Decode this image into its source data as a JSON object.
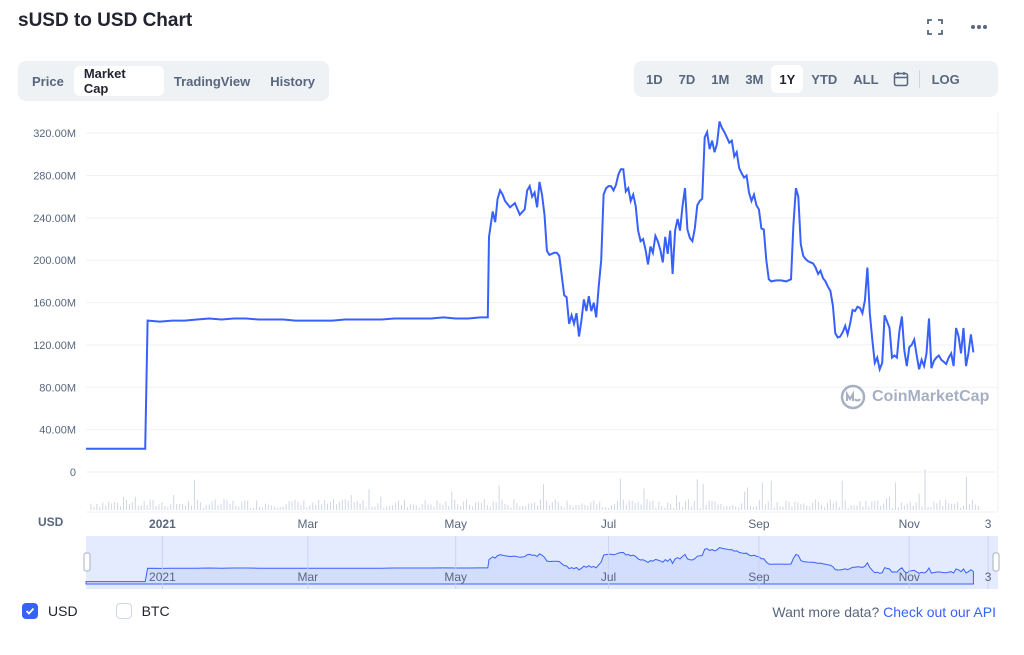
{
  "header": {
    "title": "sUSD to USD Chart"
  },
  "icons": {
    "fullscreen": "fullscreen-icon",
    "more": "more-icon",
    "calendar": "calendar-icon",
    "logo": "coinmarketcap-logo-icon"
  },
  "tabs": [
    {
      "label": "Price",
      "active": false
    },
    {
      "label": "Market Cap",
      "active": true
    },
    {
      "label": "TradingView",
      "active": false
    },
    {
      "label": "History",
      "active": false
    }
  ],
  "ranges": [
    {
      "label": "1D",
      "active": false
    },
    {
      "label": "7D",
      "active": false
    },
    {
      "label": "1M",
      "active": false
    },
    {
      "label": "3M",
      "active": false
    },
    {
      "label": "1Y",
      "active": true
    },
    {
      "label": "YTD",
      "active": false
    },
    {
      "label": "ALL",
      "active": false
    }
  ],
  "log_label": "LOG",
  "watermark": "CoinMarketCap",
  "currency_label": "USD",
  "legend": [
    {
      "label": "USD",
      "checked": true
    },
    {
      "label": "BTC",
      "checked": false
    }
  ],
  "footer": {
    "prefix": "Want more data?",
    "link": "Check out our API"
  },
  "colors": {
    "line": "#3861fb",
    "grid": "#eff2f5",
    "text": "#58667e",
    "volume": "#cfd6e4",
    "navigator": "#e5ebff"
  },
  "chart_data": {
    "type": "line",
    "series": [
      {
        "name": "USD",
        "values_in_millions": true
      }
    ],
    "ylabel": "",
    "ylim": [
      0,
      340
    ],
    "yticks": [
      "0",
      "40.00M",
      "80.00M",
      "120.00M",
      "160.00M",
      "200.00M",
      "240.00M",
      "280.00M",
      "320.00M"
    ],
    "ytick_values": [
      0,
      40,
      80,
      120,
      160,
      200,
      240,
      280,
      320
    ],
    "xticks": [
      "2021",
      "Mar",
      "May",
      "Jul",
      "Sep",
      "Nov",
      "3"
    ],
    "xtick_positions_days": [
      31,
      90,
      150,
      212,
      273,
      334,
      366
    ],
    "xlim_days": [
      0,
      370
    ],
    "points": [
      [
        0,
        22
      ],
      [
        24,
        22
      ],
      [
        25,
        143
      ],
      [
        30,
        142
      ],
      [
        35,
        143
      ],
      [
        40,
        143
      ],
      [
        45,
        144
      ],
      [
        50,
        145
      ],
      [
        55,
        144
      ],
      [
        60,
        145
      ],
      [
        65,
        145
      ],
      [
        70,
        144
      ],
      [
        75,
        144
      ],
      [
        80,
        144
      ],
      [
        85,
        143
      ],
      [
        90,
        143
      ],
      [
        95,
        143
      ],
      [
        100,
        143
      ],
      [
        105,
        144
      ],
      [
        110,
        144
      ],
      [
        115,
        144
      ],
      [
        120,
        144
      ],
      [
        125,
        145
      ],
      [
        130,
        145
      ],
      [
        135,
        145
      ],
      [
        140,
        145
      ],
      [
        145,
        146
      ],
      [
        150,
        145
      ],
      [
        155,
        145
      ],
      [
        160,
        146
      ],
      [
        163,
        146
      ],
      [
        163.5,
        222
      ],
      [
        165,
        246
      ],
      [
        166,
        236
      ],
      [
        167,
        258
      ],
      [
        168,
        266
      ],
      [
        169,
        262
      ],
      [
        170,
        256
      ],
      [
        172,
        250
      ],
      [
        174,
        254
      ],
      [
        176,
        243
      ],
      [
        178,
        248
      ],
      [
        179,
        266
      ],
      [
        180,
        270
      ],
      [
        181,
        260
      ],
      [
        182,
        264
      ],
      [
        183,
        250
      ],
      [
        184,
        274
      ],
      [
        185,
        262
      ],
      [
        186,
        243
      ],
      [
        187,
        209
      ],
      [
        188,
        205
      ],
      [
        190,
        207
      ],
      [
        191,
        207
      ],
      [
        192,
        204
      ],
      [
        194,
        167
      ],
      [
        195,
        165
      ],
      [
        196,
        140
      ],
      [
        197,
        148
      ],
      [
        198,
        140
      ],
      [
        199,
        150
      ],
      [
        200,
        128
      ],
      [
        201,
        143
      ],
      [
        202,
        163
      ],
      [
        203,
        152
      ],
      [
        204,
        166
      ],
      [
        205,
        152
      ],
      [
        206,
        160
      ],
      [
        207,
        146
      ],
      [
        208,
        175
      ],
      [
        209,
        200
      ],
      [
        210,
        262
      ],
      [
        211,
        268
      ],
      [
        212,
        270
      ],
      [
        213,
        270
      ],
      [
        214,
        266
      ],
      [
        215,
        271
      ],
      [
        216,
        281
      ],
      [
        217,
        286
      ],
      [
        218,
        286
      ],
      [
        219,
        265
      ],
      [
        220,
        268
      ],
      [
        221,
        256
      ],
      [
        222,
        262
      ],
      [
        223,
        251
      ],
      [
        224,
        228
      ],
      [
        225,
        218
      ],
      [
        226,
        220
      ],
      [
        227,
        210
      ],
      [
        228,
        196
      ],
      [
        229,
        213
      ],
      [
        230,
        207
      ],
      [
        231,
        223
      ],
      [
        232,
        218
      ],
      [
        233,
        210
      ],
      [
        234,
        198
      ],
      [
        235,
        222
      ],
      [
        236,
        206
      ],
      [
        237,
        228
      ],
      [
        238,
        187
      ],
      [
        239,
        228
      ],
      [
        240,
        239
      ],
      [
        241,
        228
      ],
      [
        242,
        251
      ],
      [
        243,
        268
      ],
      [
        244,
        229
      ],
      [
        245,
        221
      ],
      [
        246,
        218
      ],
      [
        247,
        230
      ],
      [
        248,
        252
      ],
      [
        249,
        256
      ],
      [
        250,
        258
      ],
      [
        251,
        316
      ],
      [
        252,
        321
      ],
      [
        253,
        305
      ],
      [
        254,
        313
      ],
      [
        255,
        302
      ],
      [
        256,
        310
      ],
      [
        257,
        331
      ],
      [
        258,
        325
      ],
      [
        259,
        321
      ],
      [
        260,
        316
      ],
      [
        261,
        311
      ],
      [
        262,
        313
      ],
      [
        263,
        298
      ],
      [
        264,
        302
      ],
      [
        265,
        287
      ],
      [
        266,
        282
      ],
      [
        267,
        278
      ],
      [
        268,
        280
      ],
      [
        269,
        264
      ],
      [
        270,
        256
      ],
      [
        271,
        262
      ],
      [
        272,
        252
      ],
      [
        273,
        248
      ],
      [
        274,
        230
      ],
      [
        275,
        229
      ],
      [
        276,
        200
      ],
      [
        277,
        182
      ],
      [
        278,
        180
      ],
      [
        280,
        181
      ],
      [
        282,
        181
      ],
      [
        284,
        180
      ],
      [
        286,
        182
      ],
      [
        287,
        233
      ],
      [
        288,
        268
      ],
      [
        289,
        260
      ],
      [
        290,
        215
      ],
      [
        291,
        204
      ],
      [
        292,
        201
      ],
      [
        293,
        199
      ],
      [
        294,
        198
      ],
      [
        295,
        197
      ],
      [
        296,
        193
      ],
      [
        297,
        187
      ],
      [
        298,
        190
      ],
      [
        299,
        183
      ],
      [
        300,
        180
      ],
      [
        301,
        175
      ],
      [
        302,
        171
      ],
      [
        303,
        157
      ],
      [
        304,
        131
      ],
      [
        305,
        127
      ],
      [
        306,
        128
      ],
      [
        307,
        132
      ],
      [
        308,
        138
      ],
      [
        309,
        130
      ],
      [
        310,
        140
      ],
      [
        311,
        153
      ],
      [
        312,
        152
      ],
      [
        313,
        156
      ],
      [
        314,
        155
      ],
      [
        315,
        150
      ],
      [
        316,
        162
      ],
      [
        317,
        193
      ],
      [
        318,
        150
      ],
      [
        319,
        125
      ],
      [
        320,
        103
      ],
      [
        321,
        108
      ],
      [
        322,
        97
      ],
      [
        323,
        103
      ],
      [
        324,
        148
      ],
      [
        325,
        142
      ],
      [
        326,
        136
      ],
      [
        327,
        108
      ],
      [
        328,
        110
      ],
      [
        329,
        108
      ],
      [
        330,
        133
      ],
      [
        331,
        147
      ],
      [
        332,
        115
      ],
      [
        333,
        100
      ],
      [
        334,
        118
      ],
      [
        335,
        120
      ],
      [
        336,
        125
      ],
      [
        337,
        110
      ],
      [
        338,
        97
      ],
      [
        339,
        106
      ],
      [
        340,
        100
      ],
      [
        341,
        112
      ],
      [
        342,
        145
      ],
      [
        343,
        98
      ],
      [
        344,
        105
      ],
      [
        345,
        108
      ],
      [
        346,
        110
      ],
      [
        347,
        106
      ],
      [
        348,
        104
      ],
      [
        349,
        102
      ],
      [
        350,
        108
      ],
      [
        351,
        112
      ],
      [
        352,
        100
      ],
      [
        353,
        136
      ],
      [
        354,
        128
      ],
      [
        355,
        112
      ],
      [
        356,
        136
      ],
      [
        357,
        100
      ],
      [
        358,
        112
      ],
      [
        359,
        130
      ],
      [
        360,
        113
      ]
    ],
    "grid": true,
    "legend_position": "bottom-left"
  }
}
